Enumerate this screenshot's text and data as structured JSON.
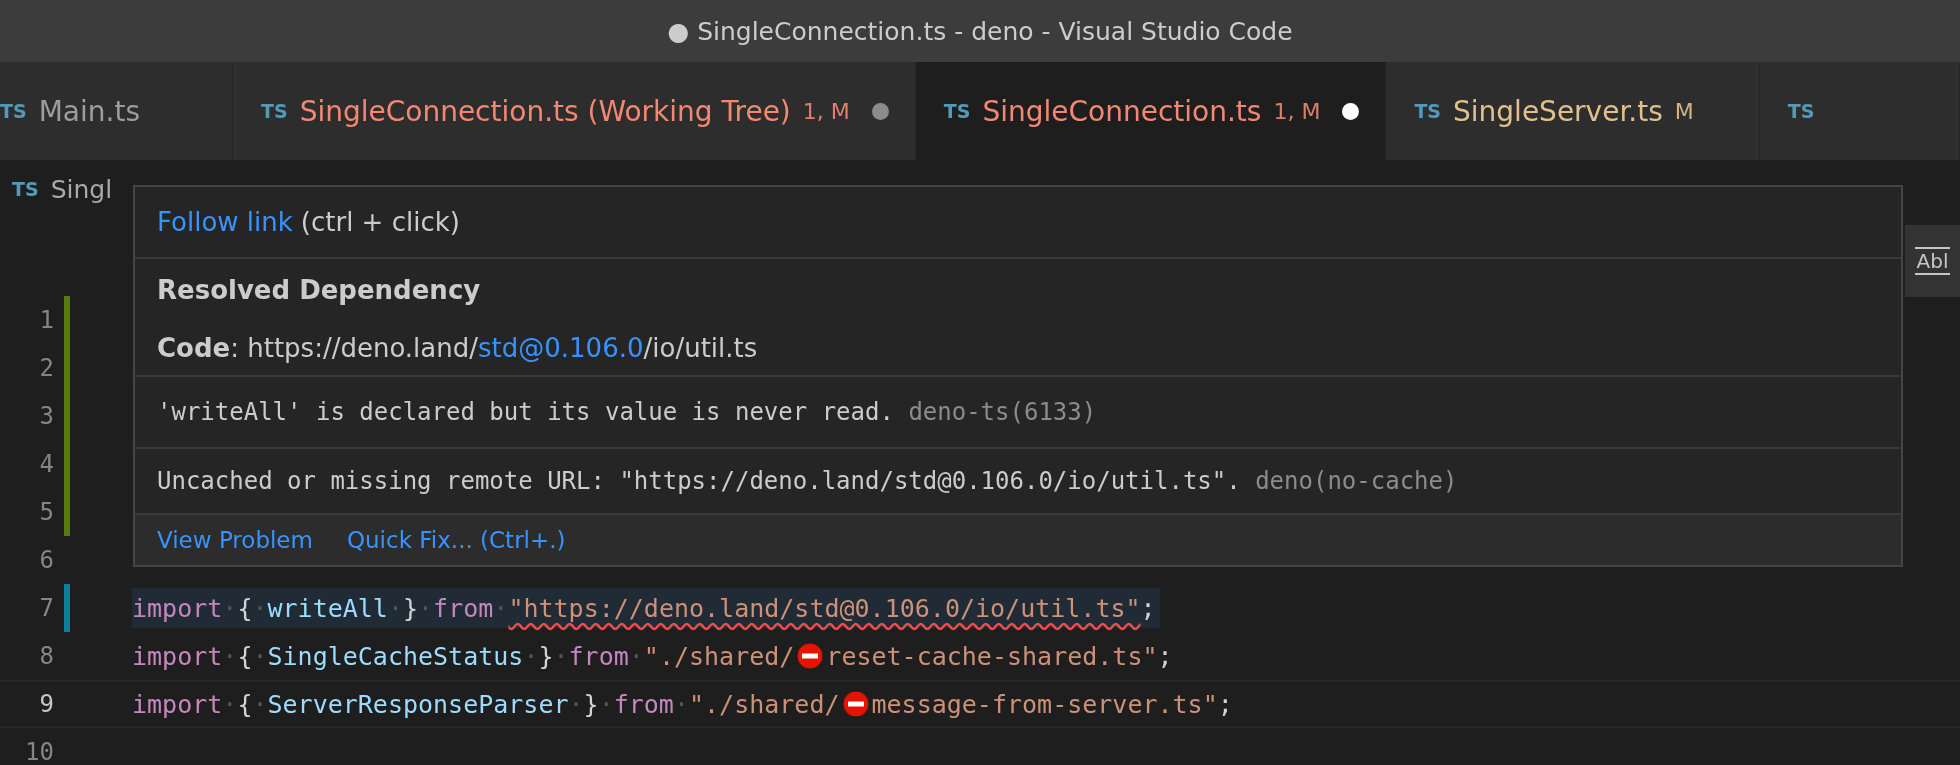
{
  "window": {
    "title": "● SingleConnection.ts - deno - Visual Studio Code"
  },
  "tabs": [
    {
      "icon_label": "TS",
      "label": "Main.ts",
      "selected": false
    },
    {
      "icon_label": "TS",
      "label": "SingleConnection.ts (Working Tree)",
      "badge": "1, M",
      "color": "#f48771",
      "dirty": true,
      "selected": false
    },
    {
      "icon_label": "TS",
      "label": "SingleConnection.ts",
      "badge": "1, M",
      "color": "#f48771",
      "dirty": true,
      "selected": true
    },
    {
      "icon_label": "TS",
      "label": "SingleServer.ts",
      "badge": "M",
      "color": "#e2c08d",
      "dirty": false,
      "selected": false
    },
    {
      "icon_label": "TS",
      "selected": false
    }
  ],
  "breadcrumb": {
    "icon_label": "TS",
    "text": "Singl"
  },
  "hover": {
    "link": "Follow link",
    "link_hint": "(ctrl + click)",
    "heading": "Resolved Dependency",
    "code": {
      "label": "Code",
      "prefix": ": https://deno.land/",
      "link": "std@0.106.0",
      "suffix": "/io/util.ts"
    },
    "messages": [
      {
        "text": "'writeAll' is declared but its value is never read.",
        "source": "deno-ts(6133)"
      },
      {
        "text": "Uncached or missing remote URL: \"https://deno.land/std@0.106.0/io/util.ts\".",
        "source": "deno(no-cache)"
      }
    ],
    "actions": [
      "View Problem",
      "Quick Fix... (Ctrl+.)"
    ]
  },
  "side_toggle": {
    "label": "Abl"
  },
  "lines": [
    {
      "number": "1",
      "added": true
    },
    {
      "number": "2",
      "added": true
    },
    {
      "number": "3",
      "added": true
    },
    {
      "number": "4",
      "added": true
    },
    {
      "number": "5",
      "added": true
    },
    {
      "number": "6"
    },
    {
      "number": "7",
      "modified": true,
      "selected": true,
      "tokens": [
        {
          "kind": "keyword",
          "text": "import"
        },
        {
          "kind": "ws",
          "text": "·"
        },
        {
          "kind": "punct",
          "text": "{"
        },
        {
          "kind": "ws",
          "text": "·"
        },
        {
          "kind": "variable",
          "text": "writeAll"
        },
        {
          "kind": "ws",
          "text": "·"
        },
        {
          "kind": "punct",
          "text": "}"
        },
        {
          "kind": "ws",
          "text": "·"
        },
        {
          "kind": "keyword",
          "text": "from"
        },
        {
          "kind": "ws",
          "text": "·"
        },
        {
          "kind": "string",
          "text": "\"https://deno.land/std@0.106.0/io/util.ts\"",
          "squiggle": true
        },
        {
          "kind": "punct",
          "text": ";"
        }
      ]
    },
    {
      "number": "8",
      "tokens": [
        {
          "kind": "keyword",
          "text": "import"
        },
        {
          "kind": "ws",
          "text": "·"
        },
        {
          "kind": "punct",
          "text": "{"
        },
        {
          "kind": "ws",
          "text": "·"
        },
        {
          "kind": "variable",
          "text": "SingleCacheStatus"
        },
        {
          "kind": "ws",
          "text": "·"
        },
        {
          "kind": "punct",
          "text": "}"
        },
        {
          "kind": "ws",
          "text": "·"
        },
        {
          "kind": "keyword",
          "text": "from"
        },
        {
          "kind": "ws",
          "text": "·"
        },
        {
          "kind": "string",
          "text": "\"./shared/"
        },
        {
          "kind": "error_icon"
        },
        {
          "kind": "string",
          "text": "reset-cache-shared.ts\""
        },
        {
          "kind": "punct",
          "text": ";"
        }
      ]
    },
    {
      "number": "9",
      "current": true,
      "tokens": [
        {
          "kind": "keyword",
          "text": "import"
        },
        {
          "kind": "ws",
          "text": "·"
        },
        {
          "kind": "punct",
          "text": "{"
        },
        {
          "kind": "ws",
          "text": "·"
        },
        {
          "kind": "variable",
          "text": "ServerResponseParser"
        },
        {
          "kind": "ws",
          "text": "·"
        },
        {
          "kind": "punct",
          "text": "}"
        },
        {
          "kind": "ws",
          "text": "·"
        },
        {
          "kind": "keyword",
          "text": "from"
        },
        {
          "kind": "ws",
          "text": "·"
        },
        {
          "kind": "string",
          "text": "\"./shared/"
        },
        {
          "kind": "error_icon"
        },
        {
          "kind": "string",
          "text": "message-from-server.ts\""
        },
        {
          "kind": "punct",
          "text": ";"
        }
      ]
    },
    {
      "number": "10"
    }
  ]
}
